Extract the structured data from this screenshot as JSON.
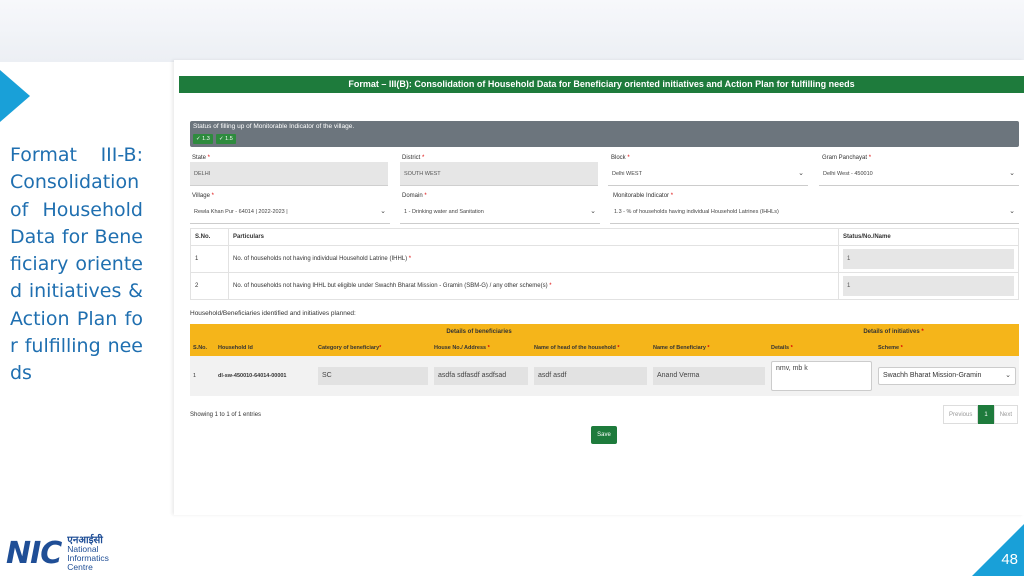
{
  "slide": {
    "title": "Format III-B: Consolidation of Household Data for Beneficiary oriented initiatives & Action Plan for fulfilling needs",
    "page_number": "48",
    "accent_color": "#19a0d8"
  },
  "logo": {
    "mark": "NIC",
    "hindi": "एनआईसी",
    "line1": "National",
    "line2": "Informatics",
    "line3": "Centre"
  },
  "form": {
    "header": "Format – III(B): Consolidation of Household Data for Beneficiary oriented initiatives and Action Plan for fulfilling needs",
    "status_label": "Status of filling up of Monitorable Indicator of the village.",
    "badges": [
      "✓ 1.3",
      "✓ 1.5"
    ],
    "state": {
      "label": "State",
      "value": "DELHI"
    },
    "district": {
      "label": "District",
      "value": "SOUTH WEST"
    },
    "block": {
      "label": "Block",
      "value": "Delhi WEST"
    },
    "gram_panchayat": {
      "label": "Gram Panchayat",
      "value": "Delhi West - 450010"
    },
    "village": {
      "label": "Village",
      "value": "Rewla Khan Pur - 64014 | 2022-2023 |"
    },
    "domain": {
      "label": "Domain",
      "value": "1 - Drinking water and Sanitation"
    },
    "indicator": {
      "label": "Monitorable Indicator",
      "value": "1.3 - % of households having individual Household Latrines (IHHLs)"
    },
    "particulars_table": {
      "headers": [
        "S.No.",
        "Particulars",
        "Status/No./Name"
      ],
      "rows": [
        {
          "sno": "1",
          "text": "No. of households not having individual Household Latrine (IHHL)",
          "value": "1"
        },
        {
          "sno": "2",
          "text": "No. of households not having IHHL but eligible under Swachh Bharat Mission - Gramin (SBM-G) / any other scheme(s)",
          "value": "1"
        }
      ]
    },
    "household_label": "Household/Beneficiaries identified and initiatives planned:",
    "beneficiary_table": {
      "group_beneficiaries": "Details of beneficiaries",
      "group_initiatives": "Details of initiatives",
      "headers": [
        "S.No.",
        "Household Id",
        "Category of beneficiary",
        "House No./ Address",
        "Name of head of the household",
        "Name of Beneficiary",
        "Details",
        "Scheme"
      ],
      "row": {
        "sno": "1",
        "household_id": "dl-sw-450010-64014-00001",
        "category": "SC",
        "address": "asdfa sdfasdf asdfsad",
        "head_name": "asdf asdf",
        "beneficiary": "Anand Verma",
        "details": "nmv, mb k",
        "scheme": "Swachh Bharat Mission-Gramin"
      }
    },
    "showing": "Showing 1 to 1 of 1 entries",
    "pager": {
      "prev": "Previous",
      "page": "1",
      "next": "Next"
    },
    "save_label": "Save"
  }
}
